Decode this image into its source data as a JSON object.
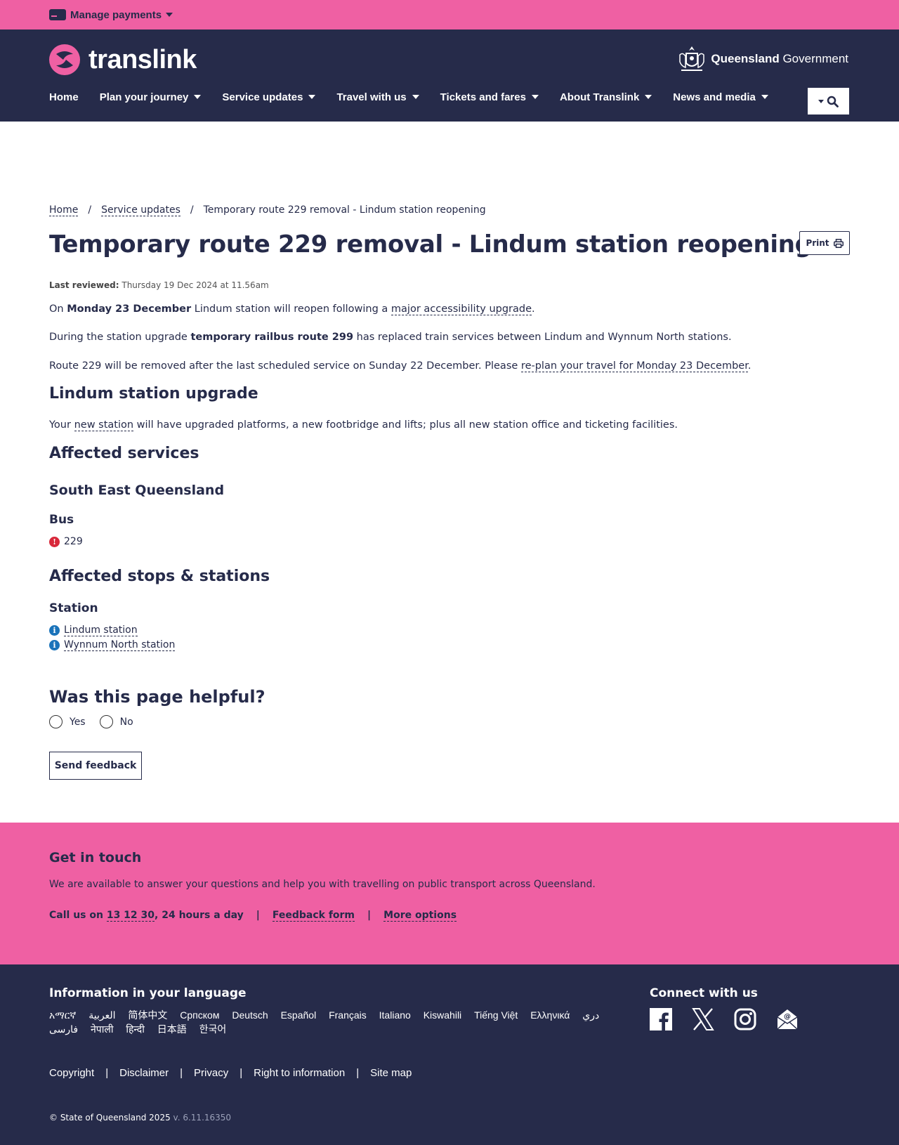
{
  "utility": {
    "manage_payments": "Manage payments"
  },
  "header": {
    "logo_text": "translink",
    "gov_bold": "Queensland",
    "gov_regular": "Government"
  },
  "nav": [
    {
      "label": "Home",
      "dropdown": false
    },
    {
      "label": "Plan your journey",
      "dropdown": true
    },
    {
      "label": "Service updates",
      "dropdown": true
    },
    {
      "label": "Travel with us",
      "dropdown": true
    },
    {
      "label": "Tickets and fares",
      "dropdown": true
    },
    {
      "label": "About Translink",
      "dropdown": true
    },
    {
      "label": "News and media",
      "dropdown": true
    }
  ],
  "breadcrumb": {
    "home": "Home",
    "sep": "/",
    "service_updates": "Service updates",
    "current": "Temporary route 229 removal - Lindum station reopening"
  },
  "page": {
    "title": "Temporary route 229 removal - Lindum station reopening",
    "print": "Print",
    "reviewed_label": "Last reviewed:",
    "reviewed_value": "Thursday 19 Dec 2024 at 11.56am",
    "p1_a": "On ",
    "p1_b": "Monday 23 December",
    "p1_c": " Lindum station will reopen following a ",
    "p1_link": "major accessibility upgrade",
    "p1_d": ".",
    "p2_a": "During the station upgrade ",
    "p2_b": "temporary railbus route 299",
    "p2_c": " has replaced train services between Lindum and Wynnum North stations.",
    "p3_a": "Route 229 will be removed after the last scheduled service on Sunday 22 December. Please ",
    "p3_link": "re-plan your travel for Monday 23 December",
    "p3_b": ".",
    "h_upgrade": "Lindum station upgrade",
    "p4_a": "Your ",
    "p4_link": "new station",
    "p4_b": " will have upgraded platforms, a new footbridge and lifts; plus all new station office and ticketing facilities.",
    "h_affected": "Affected services",
    "h_region": "South East Queensland",
    "h_bus": "Bus",
    "bus_route": "229",
    "h_stops": "Affected stops & stations",
    "h_station": "Station",
    "stations": [
      "Lindum station",
      "Wynnum North station"
    ],
    "h_helpful": "Was this page helpful?",
    "yes": "Yes",
    "no": "No",
    "send": "Send feedback"
  },
  "touch": {
    "title": "Get in touch",
    "text": "We are available to answer your questions and help you with travelling on public transport across Queensland.",
    "call_a": "Call us on ",
    "call_number": "13 12 30",
    "call_b": ", 24 hours a day",
    "sep": "|",
    "feedback": "Feedback form",
    "more": "More options"
  },
  "footer": {
    "lang_title": "Information in your language",
    "languages": [
      "አማርኛ",
      "العربية",
      "简体中文",
      "Српском",
      "Deutsch",
      "Español",
      "Français",
      "Italiano",
      "Kiswahili",
      "Tiếng Việt",
      "Ελληνικά",
      "دري",
      "فارسی",
      "नेपाली",
      "हिन्दी",
      "日本語",
      "한국어"
    ],
    "connect_title": "Connect with us",
    "socials": [
      "facebook-icon",
      "x-icon",
      "instagram-icon",
      "email-icon"
    ],
    "legal": [
      "Copyright",
      "Disclaimer",
      "Privacy",
      "Right to information",
      "Site map"
    ],
    "legal_sep": "|",
    "copyright": "© State of Queensland 2025",
    "version": "v. 6.11.16350"
  },
  "colors": {
    "navy": "#262b4a",
    "pink": "#ef60a3",
    "warning": "#d8283a",
    "info": "#1a73ba"
  }
}
